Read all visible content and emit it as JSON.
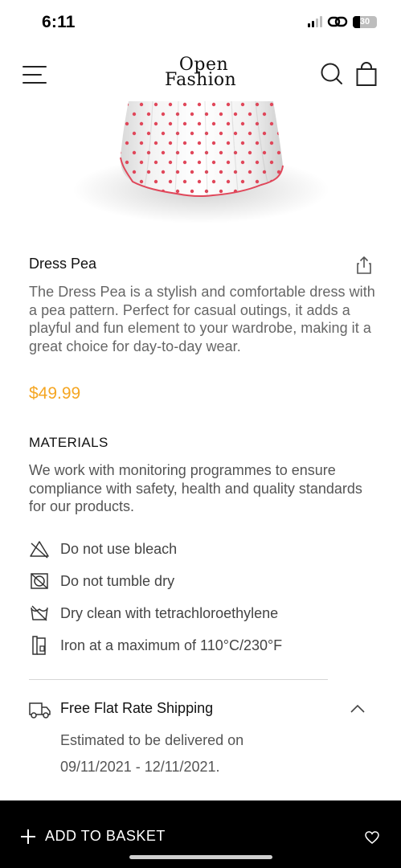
{
  "status_bar": {
    "time": "6:11",
    "battery": "30",
    "battery_level": 0.3
  },
  "header": {
    "logo_line1": "Open",
    "logo_line2": "Fashion",
    "menu_icon": "menu-icon",
    "search_icon": "search-icon",
    "bag_icon": "shopping-bag-icon"
  },
  "product": {
    "title": "Dress Pea",
    "description": "The Dress Pea is a stylish and comfortable dress with a pea pattern. Perfect for casual outings, it adds a playful and fun element to your wardrobe, making it a great choice for day-to-day wear.",
    "price": "$49.99",
    "price_color": "#f5a623",
    "dot_color": "#e0475a"
  },
  "materials": {
    "title": "MATERIALS",
    "description": "We work with monitoring programmes to ensure compliance with safety, health and quality standards for our products."
  },
  "care": [
    {
      "icon": "no-bleach-icon",
      "label": "Do not use bleach"
    },
    {
      "icon": "no-tumble-dry-icon",
      "label": "Do not tumble dry"
    },
    {
      "icon": "dry-clean-icon",
      "label": "Dry clean with tetrachloroethylene"
    },
    {
      "icon": "iron-icon",
      "label": "Iron at a maximum of 110°C/230°F"
    }
  ],
  "shipping": {
    "title": "Free Flat Rate Shipping",
    "line1": "Estimated to be delivered on",
    "line2": "09/11/2021 - 12/11/2021."
  },
  "bottom_bar": {
    "add_label": "ADD TO BASKET"
  }
}
